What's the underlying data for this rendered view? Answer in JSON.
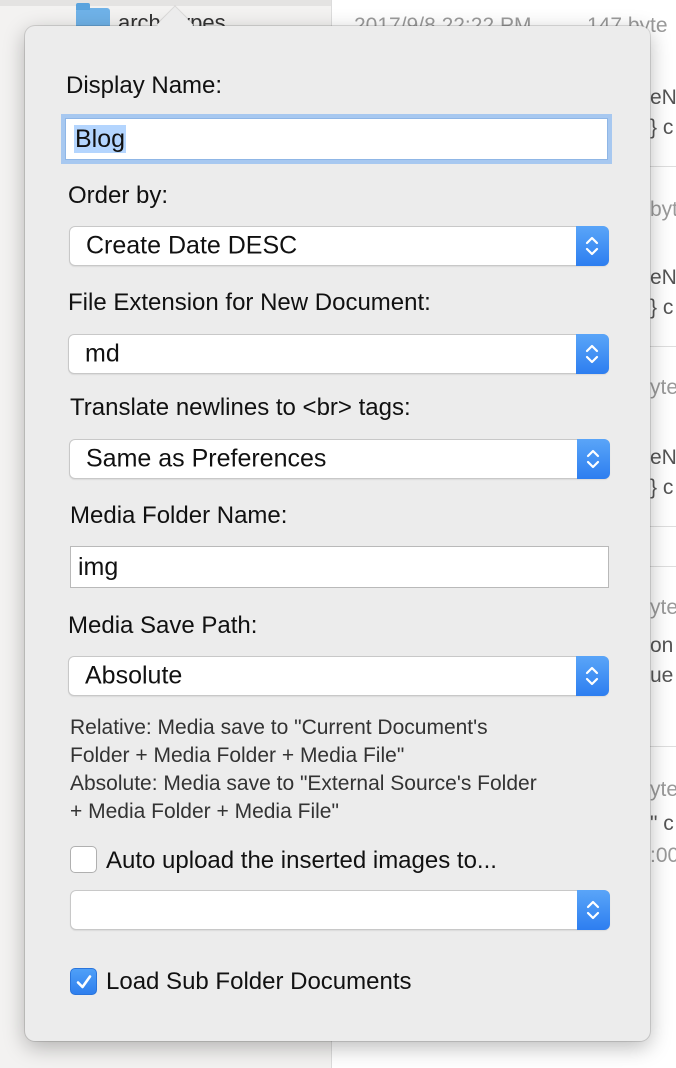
{
  "background": {
    "sidebar_folder_label": "archetypes",
    "list_fragments": {
      "date_line": "2017/9/8 22:22 PM",
      "size_line": "147 byte",
      "r1a": "eN",
      "r1b": "} c",
      "r2a": "byt",
      "r3a": "eN",
      "r3b": "} c",
      "r4a": "ytes",
      "r5a": "eN",
      "r5b": "} c",
      "r6a": "ytes",
      "r6b": "on",
      "r6c": "ue",
      "r7a": "yte",
      "r7b": "\" c",
      "r7c": ":00"
    }
  },
  "popover": {
    "display_name": {
      "label": "Display Name:",
      "value": "Blog"
    },
    "order_by": {
      "label": "Order by:",
      "value": "Create Date DESC"
    },
    "file_extension": {
      "label": "File Extension for New Document:",
      "value": "md"
    },
    "translate_newlines": {
      "label": "Translate newlines to <br> tags:",
      "value": "Same as Preferences"
    },
    "media_folder_name": {
      "label": "Media Folder Name:",
      "value": "img"
    },
    "media_save_path": {
      "label": "Media Save Path:",
      "value": "Absolute"
    },
    "help_lines": [
      "Relative: Media save to \"Current Document's",
      "Folder + Media Folder + Media File\"",
      "Absolute: Media save to \"External Source's Folder",
      "+ Media Folder + Media File\""
    ],
    "auto_upload": {
      "label": "Auto upload the inserted images to...",
      "checked": false,
      "service_value": ""
    },
    "load_sub_folder": {
      "label": "Load Sub Folder Documents",
      "checked": true
    }
  },
  "colors": {
    "accent": "#2d7ef0",
    "focus_ring": "#a7c8f0",
    "selection": "#b4d5fe",
    "popover_bg": "#ececec"
  },
  "icons": [
    "folder-icon",
    "stepper-icon",
    "checkmark-icon"
  ]
}
